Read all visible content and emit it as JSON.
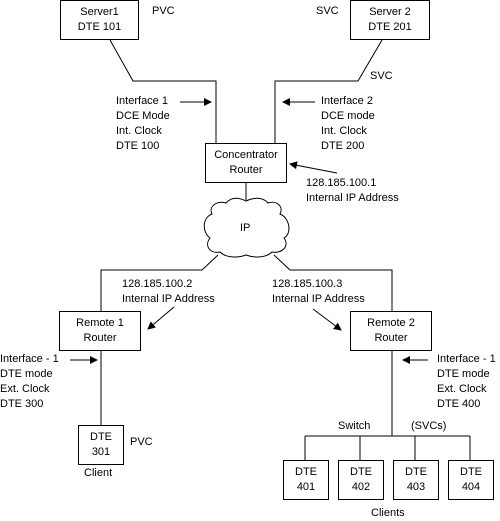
{
  "nodes": {
    "server1": {
      "line1": "Server1",
      "line2": "DTE 101"
    },
    "server2": {
      "line1": "Server 2",
      "line2": "DTE 201"
    },
    "concentrator": {
      "line1": "Concentrator",
      "line2": "Router"
    },
    "remote1": {
      "line1": "Remote 1",
      "line2": "Router"
    },
    "remote2": {
      "line1": "Remote 2",
      "line2": "Router"
    },
    "dte301": {
      "line1": "DTE",
      "line2": "301"
    },
    "dte401": {
      "line1": "DTE",
      "line2": "401"
    },
    "dte402": {
      "line1": "DTE",
      "line2": "402"
    },
    "dte403": {
      "line1": "DTE",
      "line2": "403"
    },
    "dte404": {
      "line1": "DTE",
      "line2": "404"
    },
    "ip_cloud": {
      "label": "IP"
    }
  },
  "labels": {
    "server1_link": "PVC",
    "server2_link": "SVC",
    "server2_line": "SVC",
    "interface1": [
      "Interface 1",
      "DCE Mode",
      "Int. Clock",
      "DTE 100"
    ],
    "interface2": [
      "Interface 2",
      "DCE mode",
      "Int. Clock",
      "DTE 200"
    ],
    "concentrator_ip": [
      "128.185.100.1",
      "Internal IP Address"
    ],
    "remote1_ip": [
      "128.185.100.2",
      "Internal IP Address"
    ],
    "remote2_ip": [
      "128.185.100.3",
      "Internal IP Address"
    ],
    "remote1_interface": [
      "Interface - 1",
      "DTE mode",
      "Ext. Clock",
      "DTE 300"
    ],
    "remote2_interface": [
      "Interface - 1",
      "DTE mode",
      "Ext. Clock",
      "DTE 400"
    ],
    "dte301_link": "PVC",
    "client": "Client",
    "switch": "Switch",
    "svcs": "(SVCs)",
    "clients": "Clients"
  }
}
